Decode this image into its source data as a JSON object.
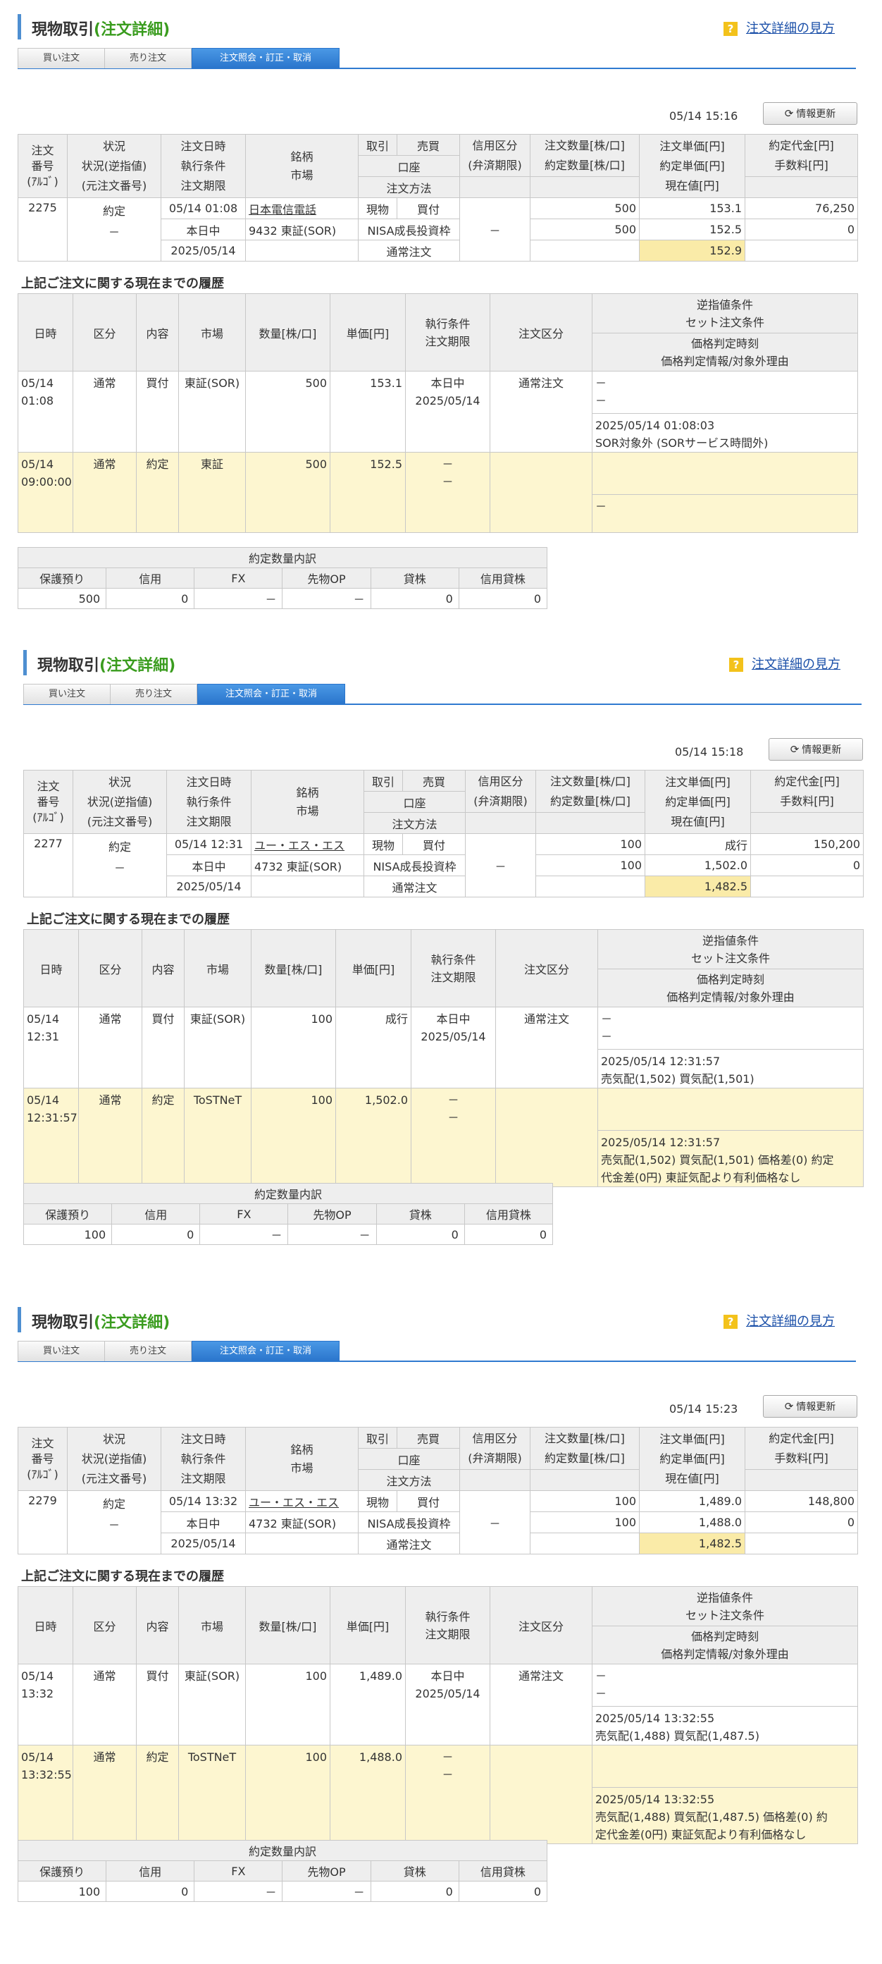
{
  "common": {
    "title_main": "現物取引",
    "title_sub": "(注文詳細)",
    "help_link": "注文詳細の見方",
    "tabs": [
      "買い注文",
      "売り注文",
      "注文照会・訂正・取消"
    ],
    "refresh_label": "情報更新",
    "history_title": "上記ご注文に関する現在までの履歴",
    "main_headers": {
      "col1": [
        "注文",
        "番号",
        "(ｱﾙｺﾞ)"
      ],
      "col2": [
        "状況",
        "状況(逆指値)",
        "(元注文番号)"
      ],
      "col3": [
        "注文日時",
        "執行条件",
        "注文期限"
      ],
      "col4": [
        "銘柄",
        "市場"
      ],
      "col5a": "取引",
      "col5b": "売買",
      "col5c": "口座",
      "col5d": "注文方法",
      "col6": [
        "信用区分",
        "(弁済期限)"
      ],
      "col7": [
        "注文数量[株/口]",
        "約定数量[株/口]"
      ],
      "col8": [
        "注文単価[円]",
        "約定単価[円]",
        "現在値[円]"
      ],
      "col9": [
        "約定代金[円]",
        "手数料[円]"
      ]
    },
    "hist_headers": {
      "h1": "日時",
      "h2": "区分",
      "h3": "内容",
      "h4": "市場",
      "h5": "数量[株/口]",
      "h6": "単価[円]",
      "h7": [
        "執行条件",
        "注文期限"
      ],
      "h8": "注文区分",
      "h9a": [
        "逆指値条件",
        "セット注文条件"
      ],
      "h9b": [
        "価格判定時刻",
        "価格判定情報/対象外理由"
      ]
    },
    "breakdown_title": "約定数量内訳",
    "breakdown_headers": [
      "保護預り",
      "信用",
      "FX",
      "先物OP",
      "貸株",
      "信用貸株"
    ]
  },
  "orders": [
    {
      "timestamp": "05/14 15:16",
      "order_no": "2275",
      "status": "約定",
      "status_sub": "－",
      "order_time": "05/14  01:08",
      "exec_cond": "本日中",
      "expiry": "2025/05/14",
      "stock_name": "日本電信電話",
      "stock_code_market": "9432  東証(SOR)",
      "trade": "現物",
      "side": "買付",
      "account": "NISA成長投資枠",
      "method": "通常注文",
      "credit": "－",
      "order_qty": "500",
      "exec_qty": "500",
      "order_price": "153.1",
      "exec_price": "152.5",
      "current_price": "152.9",
      "exec_amount": "76,250",
      "fee": "0",
      "history": [
        {
          "time": [
            "05/14",
            "01:08"
          ],
          "kubun": "通常",
          "naiyo": "買付",
          "market": "東証(SOR)",
          "qty": "500",
          "price": "153.1",
          "cond": [
            "本日中",
            "2025/05/14"
          ],
          "order_type": "通常注文",
          "stop": [
            "－",
            "－"
          ],
          "judge": [
            "2025/05/14 01:08:03",
            "SOR対象外 (SORサービス時間外)"
          ]
        },
        {
          "time": [
            "05/14",
            "09:00:00"
          ],
          "kubun": "通常",
          "naiyo": "約定",
          "market": "東証",
          "qty": "500",
          "price": "152.5",
          "cond": [
            "－",
            "－"
          ],
          "order_type": "",
          "stop": [],
          "judge": [
            "－"
          ]
        }
      ],
      "breakdown": [
        "500",
        "0",
        "－",
        "－",
        "0",
        "0"
      ]
    },
    {
      "timestamp": "05/14 15:18",
      "order_no": "2277",
      "status": "約定",
      "status_sub": "－",
      "order_time": "05/14  12:31",
      "exec_cond": "本日中",
      "expiry": "2025/05/14",
      "stock_name": "ユー・エス・エス",
      "stock_code_market": "4732  東証(SOR)",
      "trade": "現物",
      "side": "買付",
      "account": "NISA成長投資枠",
      "method": "通常注文",
      "credit": "－",
      "order_qty": "100",
      "exec_qty": "100",
      "order_price": "成行",
      "exec_price": "1,502.0",
      "current_price": "1,482.5",
      "exec_amount": "150,200",
      "fee": "0",
      "history": [
        {
          "time": [
            "05/14",
            "12:31"
          ],
          "kubun": "通常",
          "naiyo": "買付",
          "market": "東証(SOR)",
          "qty": "100",
          "price": "成行",
          "cond": [
            "本日中",
            "2025/05/14"
          ],
          "order_type": "通常注文",
          "stop": [
            "－",
            "－"
          ],
          "judge": [
            "2025/05/14 12:31:57",
            "売気配(1,502) 買気配(1,501)"
          ]
        },
        {
          "time": [
            "05/14",
            "12:31:57"
          ],
          "kubun": "通常",
          "naiyo": "約定",
          "market": "ToSTNeT",
          "qty": "100",
          "price": "1,502.0",
          "cond": [
            "－",
            "－"
          ],
          "order_type": "",
          "stop": [],
          "judge": [
            "2025/05/14 12:31:57",
            "売気配(1,502) 買気配(1,501) 価格差(0) 約定",
            "代金差(0円) 東証気配より有利価格なし"
          ]
        }
      ],
      "breakdown": [
        "100",
        "0",
        "－",
        "－",
        "0",
        "0"
      ]
    },
    {
      "timestamp": "05/14 15:23",
      "order_no": "2279",
      "status": "約定",
      "status_sub": "－",
      "order_time": "05/14  13:32",
      "exec_cond": "本日中",
      "expiry": "2025/05/14",
      "stock_name": "ユー・エス・エス",
      "stock_code_market": "4732  東証(SOR)",
      "trade": "現物",
      "side": "買付",
      "account": "NISA成長投資枠",
      "method": "通常注文",
      "credit": "－",
      "order_qty": "100",
      "exec_qty": "100",
      "order_price": "1,489.0",
      "exec_price": "1,488.0",
      "current_price": "1,482.5",
      "exec_amount": "148,800",
      "fee": "0",
      "history": [
        {
          "time": [
            "05/14",
            "13:32"
          ],
          "kubun": "通常",
          "naiyo": "買付",
          "market": "東証(SOR)",
          "qty": "100",
          "price": "1,489.0",
          "cond": [
            "本日中",
            "2025/05/14"
          ],
          "order_type": "通常注文",
          "stop": [
            "－",
            "－"
          ],
          "judge": [
            "2025/05/14 13:32:55",
            "売気配(1,488) 買気配(1,487.5)"
          ]
        },
        {
          "time": [
            "05/14",
            "13:32:55"
          ],
          "kubun": "通常",
          "naiyo": "約定",
          "market": "ToSTNeT",
          "qty": "100",
          "price": "1,488.0",
          "cond": [
            "－",
            "－"
          ],
          "order_type": "",
          "stop": [],
          "judge": [
            "2025/05/14 13:32:55",
            "売気配(1,488) 買気配(1,487.5) 価格差(0) 約",
            "定代金差(0円) 東証気配より有利価格なし"
          ]
        }
      ],
      "breakdown": [
        "100",
        "0",
        "－",
        "－",
        "0",
        "0"
      ]
    }
  ]
}
